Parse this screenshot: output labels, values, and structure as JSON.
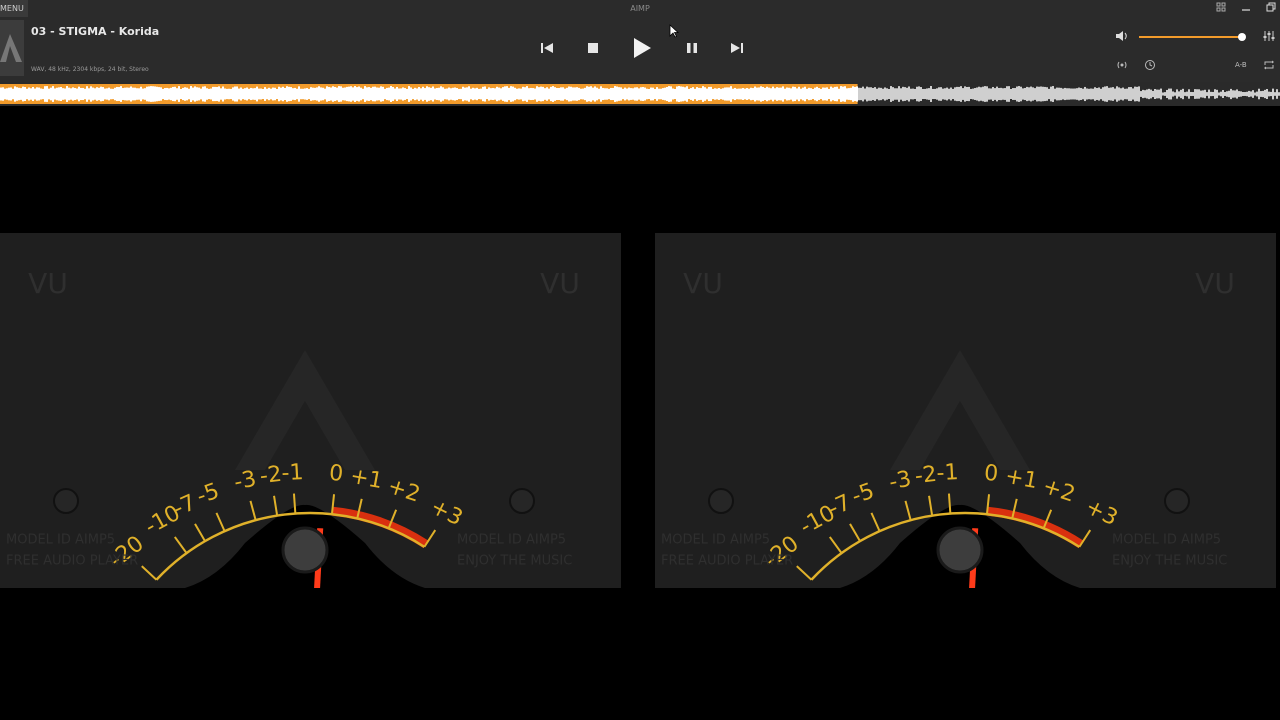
{
  "window": {
    "menu_label": "MENU",
    "title": "AIMP"
  },
  "track": {
    "title": "03 - STIGMA - Korida",
    "info": "WAV, 48 kHz, 2304 kbps, 24 bit, Stereo"
  },
  "volume": {
    "level": 0.98
  },
  "playback": {
    "progress": 0.67
  },
  "extras": {
    "ab_label": "A-B"
  },
  "vu": {
    "label": "VU",
    "scale": [
      "-20",
      "-10",
      "-7",
      "-5",
      "-3",
      "-2",
      "-1",
      "0",
      "+1",
      "+2",
      "+3"
    ],
    "model_line": "MODEL ID AIMP5",
    "left_tagline": "FREE AUDIO PLAYER",
    "right_tagline": "ENJOY THE MUSIC"
  },
  "colors": {
    "accent": "#f29b2b",
    "needle": "#ff3b1a",
    "scale": "#e0b12a",
    "red_zone": "#d9300f"
  }
}
